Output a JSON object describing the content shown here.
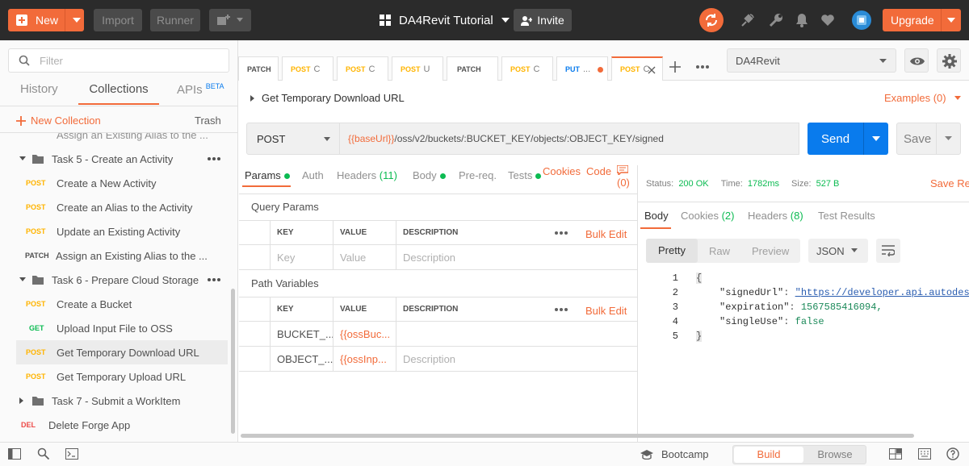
{
  "header": {
    "new_label": "New",
    "import_label": "Import",
    "runner_label": "Runner",
    "workspace": "DA4Revit Tutorial",
    "invite_label": "Invite",
    "upgrade_label": "Upgrade"
  },
  "sidebar": {
    "filter_placeholder": "Filter",
    "tabs": {
      "history": "History",
      "collections": "Collections",
      "apis": "APIs",
      "beta": "BETA"
    },
    "new_collection": "New Collection",
    "trash": "Trash",
    "cut_item": "Assign an Existing Alias to the ...",
    "folder5": "Task 5 - Create an Activity",
    "folder6": "Task 6 - Prepare Cloud Storage",
    "folder7": "Task 7 - Submit a WorkItem",
    "items": [
      {
        "method": "POST",
        "label": "Create a New Activity"
      },
      {
        "method": "POST",
        "label": "Create an Alias to the Activity"
      },
      {
        "method": "POST",
        "label": "Update an Existing Activity"
      },
      {
        "method": "PATCH",
        "label": "Assign an Existing Alias to the ..."
      },
      {
        "method": "POST",
        "label": "Create a Bucket"
      },
      {
        "method": "GET",
        "label": "Upload Input File to OSS"
      },
      {
        "method": "POST",
        "label": "Get Temporary Download URL"
      },
      {
        "method": "POST",
        "label": "Get Temporary Upload URL"
      },
      {
        "method": "DEL",
        "label": "Delete Forge App"
      }
    ]
  },
  "tabs": [
    {
      "method": "PATCH",
      "title": ""
    },
    {
      "method": "POST",
      "title": "C"
    },
    {
      "method": "POST",
      "title": "C"
    },
    {
      "method": "POST",
      "title": "U"
    },
    {
      "method": "PATCH",
      "title": ""
    },
    {
      "method": "POST",
      "title": "C"
    },
    {
      "method": "PUT",
      "title": "..."
    },
    {
      "method": "POST",
      "title": "C"
    }
  ],
  "environment": "DA4Revit",
  "request": {
    "name": "Get Temporary Download URL",
    "examples": "Examples (0)",
    "method": "POST",
    "url_var": "{{baseUrl}}",
    "url_rest": "/oss/v2/buckets/:BUCKET_KEY/objects/:OBJECT_KEY/signed",
    "send": "Send",
    "save": "Save"
  },
  "req_tabs": {
    "params": "Params",
    "auth": "Auth",
    "headers": "Headers",
    "headers_count": "(11)",
    "body": "Body",
    "prereq": "Pre-req.",
    "tests": "Tests",
    "cookies": "Cookies",
    "code": "Code",
    "comments_count": "(0)"
  },
  "query_params": {
    "title": "Query Params",
    "cols": {
      "key": "KEY",
      "value": "VALUE",
      "description": "DESCRIPTION"
    },
    "bulk_edit": "Bulk Edit",
    "placeholder": {
      "key": "Key",
      "value": "Value",
      "description": "Description"
    }
  },
  "path_variables": {
    "title": "Path Variables",
    "bulk_edit": "Bulk Edit",
    "rows": [
      {
        "key": "BUCKET_...",
        "value": "{{ossBuc...",
        "description": ""
      },
      {
        "key": "OBJECT_...",
        "value": "{{ossInp...",
        "description": "Description"
      }
    ]
  },
  "response": {
    "status_label": "Status:",
    "status": "200 OK",
    "time_label": "Time:",
    "time": "1782ms",
    "size_label": "Size:",
    "size": "527 B",
    "save_response": "Save Res",
    "tabs": {
      "body": "Body",
      "cookies": "Cookies",
      "cookies_count": "(2)",
      "headers": "Headers",
      "headers_count": "(8)",
      "test_results": "Test Results"
    },
    "views": {
      "pretty": "Pretty",
      "raw": "Raw",
      "preview": "Preview",
      "format": "JSON"
    },
    "lines": [
      {
        "num": "1",
        "text": "{"
      },
      {
        "num": "2",
        "key": "\"signedUrl\"",
        "value": "\"https://developer.api.autodesk"
      },
      {
        "num": "3",
        "key": "\"expiration\"",
        "value": "1567585416094,"
      },
      {
        "num": "4",
        "key": "\"singleUse\"",
        "value": "false"
      },
      {
        "num": "5",
        "text": "}"
      }
    ]
  },
  "footer": {
    "bootcamp": "Bootcamp",
    "build": "Build",
    "browse": "Browse"
  },
  "colors": {
    "accent": "#f26b3a",
    "primary_blue": "#097bed",
    "post": "#ffb400",
    "get": "#0cbb52",
    "delete": "#ed4b48"
  }
}
